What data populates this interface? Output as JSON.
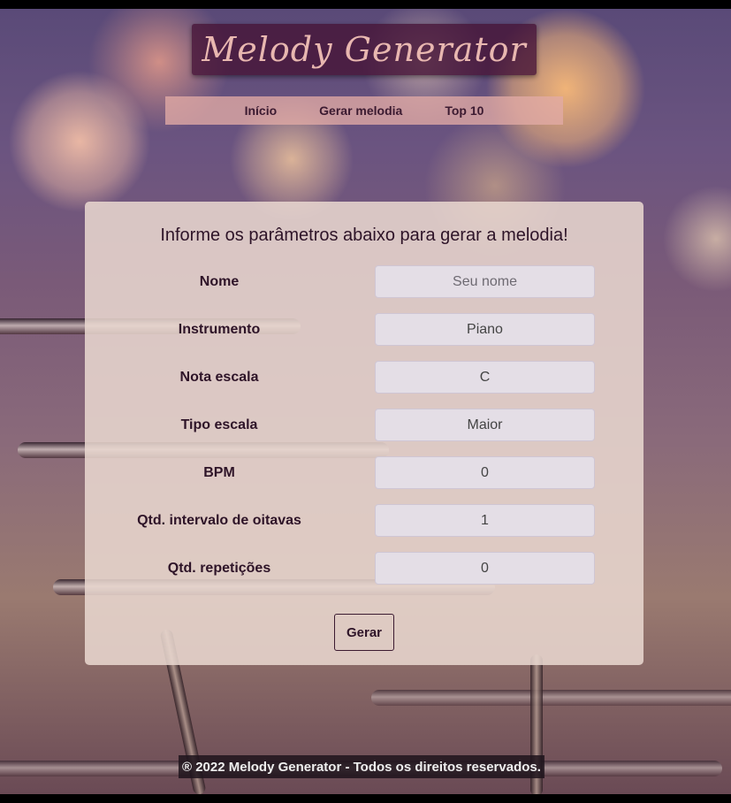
{
  "header": {
    "title": "Melody Generator"
  },
  "nav": {
    "items": [
      "Início",
      "Gerar melodia",
      "Top 10"
    ]
  },
  "form": {
    "heading": "Informe os parâmetros abaixo para gerar a melodia!",
    "fields": [
      {
        "label": "Nome",
        "value": "",
        "placeholder": "Seu nome"
      },
      {
        "label": "Instrumento",
        "value": "Piano",
        "placeholder": ""
      },
      {
        "label": "Nota escala",
        "value": "C",
        "placeholder": ""
      },
      {
        "label": "Tipo escala",
        "value": "Maior",
        "placeholder": ""
      },
      {
        "label": "BPM",
        "value": "0",
        "placeholder": ""
      },
      {
        "label": "Qtd. intervalo de oitavas",
        "value": "1",
        "placeholder": ""
      },
      {
        "label": "Qtd. repetições",
        "value": "0",
        "placeholder": ""
      }
    ],
    "submit_label": "Gerar"
  },
  "footer": {
    "text": "® 2022 Melody Generator - Todos os direitos reservados."
  },
  "colors": {
    "accent": "#461437",
    "nav_bg": "#e1aaa5",
    "card_bg": "#ead9d0"
  }
}
